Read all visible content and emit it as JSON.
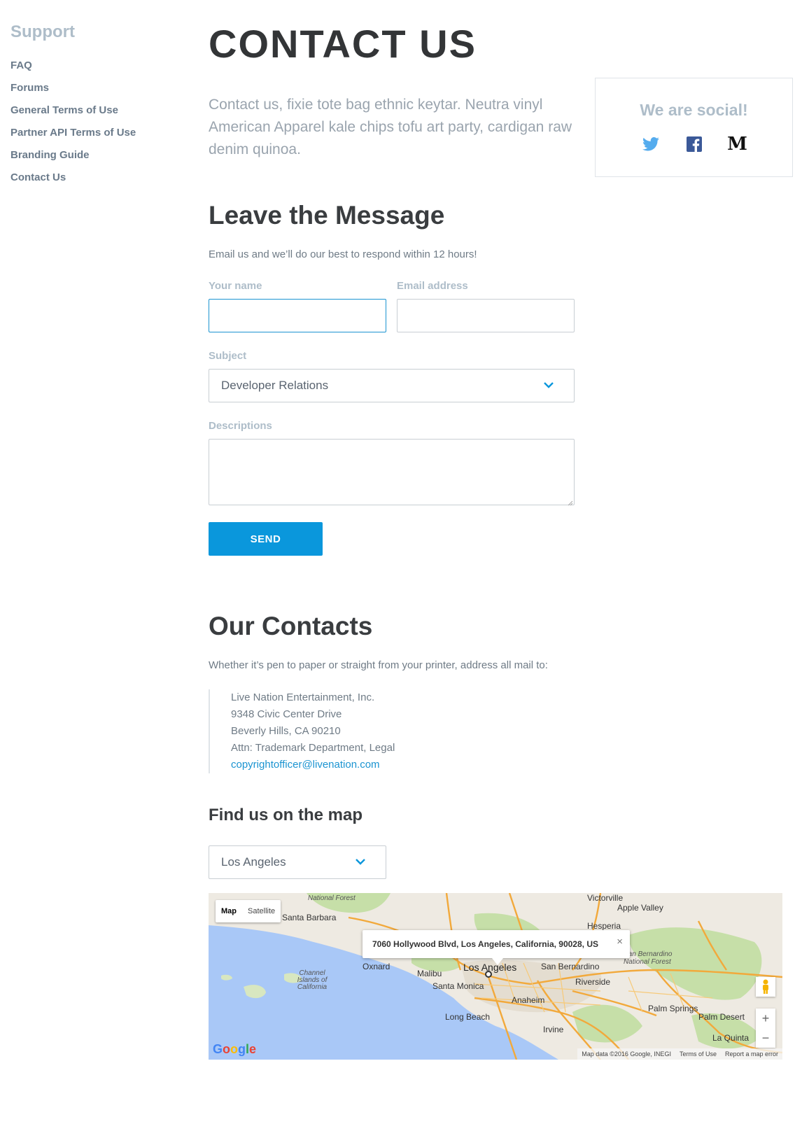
{
  "sidebar": {
    "title": "Support",
    "items": [
      {
        "label": "FAQ"
      },
      {
        "label": "Forums"
      },
      {
        "label": "General Terms of Use"
      },
      {
        "label": "Partner API Terms of Use"
      },
      {
        "label": "Branding Guide"
      },
      {
        "label": "Contact Us"
      }
    ]
  },
  "page": {
    "title": "CONTACT US",
    "intro": "Contact us, fixie tote bag ethnic keytar. Neutra vinyl American Apparel kale chips tofu art party, cardigan raw denim quinoa."
  },
  "social": {
    "title": "We are social!",
    "icons": [
      "twitter-icon",
      "facebook-icon",
      "medium-icon"
    ],
    "medium_glyph": "M",
    "colors": {
      "twitter": "#55acee",
      "facebook": "#3b5998",
      "medium": "#111111"
    }
  },
  "message": {
    "title": "Leave the Message",
    "subtitle": "Email us and we’ll do our best to respond within 12 hours!",
    "name_label": "Your name",
    "name_value": "",
    "email_label": "Email address",
    "email_value": "",
    "subject_label": "Subject",
    "subject_value": "Developer Relations",
    "description_label": "Descriptions",
    "description_value": "",
    "send_label": "SEND"
  },
  "contacts": {
    "title": "Our Contacts",
    "subtitle": "Whether it’s pen to paper or straight from your printer, address all mail to:",
    "address_lines": [
      "Live Nation Entertainment, Inc.",
      "9348 Civic Center Drive",
      "Beverly Hills, CA 90210",
      "Attn: Trademark Department, Legal"
    ],
    "email": "copyrightofficer@livenation.com"
  },
  "map_section": {
    "title": "Find us on the map",
    "location_value": "Los Angeles",
    "map_type_options": [
      "Map",
      "Satellite"
    ],
    "selected_map_type": "Map",
    "popup_text": "7060 Hollywood Blvd, Los Angeles, California, 90028, US",
    "popup_close": "×",
    "zoom_in": "+",
    "zoom_out": "−",
    "google_logo": "Google",
    "footer": [
      "Map data ©2016 Google, INEGI",
      "Terms of Use",
      "Report a map error"
    ],
    "place_labels": {
      "victorville": "Victorville",
      "apple_valley": "Apple Valley",
      "hesperia": "Hesperia",
      "santa_barbara": "Santa Barbara",
      "national_forest": "National Forest",
      "oxnard": "Oxnard",
      "malibu": "Malibu",
      "los_angeles": "Los Angeles",
      "san_bernardino": "San Bernardino",
      "san_bernardino_nf": "San Bernardino National Forest",
      "riverside": "Riverside",
      "santa_monica": "Santa Monica",
      "anaheim": "Anaheim",
      "long_beach": "Long Beach",
      "irvine": "Irvine",
      "palm_springs": "Palm Springs",
      "palm_desert": "Palm Desert",
      "la_quinta": "La Quinta",
      "channel_islands": "Channel Islands of California"
    },
    "colors": {
      "water": "#a9c8f7",
      "land": "#eeeae2",
      "park": "#c6dfa8",
      "highway": "#f2a93b"
    }
  },
  "colors": {
    "accent": "#0a97dc",
    "link": "#1b94d1",
    "muted_heading": "#aebdc9"
  }
}
